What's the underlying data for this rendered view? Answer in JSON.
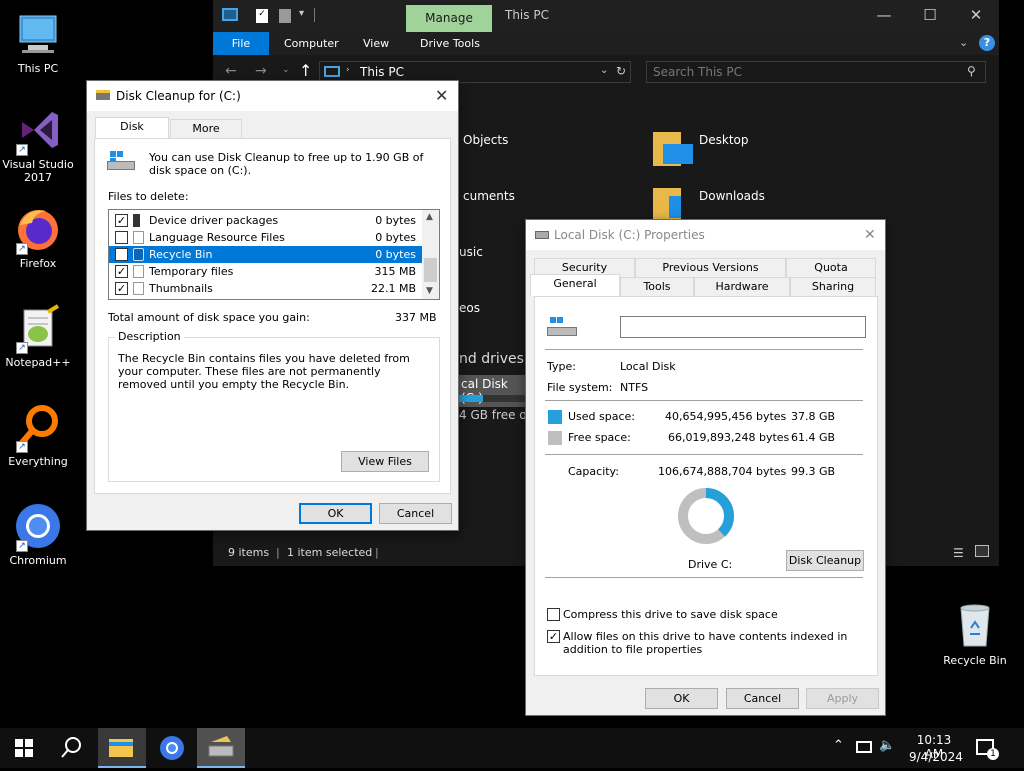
{
  "desktop": {
    "icons": [
      {
        "label": "This PC",
        "icon": "monitor-icon"
      },
      {
        "label": "Visual Studio 2017",
        "icon": "visual-studio-icon"
      },
      {
        "label": "Firefox",
        "icon": "firefox-icon"
      },
      {
        "label": "Notepad++",
        "icon": "notepadpp-icon"
      },
      {
        "label": "Everything",
        "icon": "magnifier-icon"
      },
      {
        "label": "Chromium",
        "icon": "chromium-icon"
      },
      {
        "label": "Recycle Bin",
        "icon": "recycle-bin-icon"
      }
    ]
  },
  "explorer": {
    "manage_tab": "Manage",
    "title": "This PC",
    "ribbon_tabs": [
      "File",
      "Computer",
      "View",
      "Drive Tools"
    ],
    "address": "This PC",
    "search_placeholder": "Search This PC",
    "folders": [
      "Objects",
      "Desktop",
      "cuments",
      "Downloads",
      "usic",
      "eos"
    ],
    "section_fragment": ")",
    "drives_heading": "nd drives",
    "drive_label": "cal Disk (C:)",
    "drive_free": "4 GB free of",
    "drive_used_fraction": 0.38,
    "status_items": "9 items",
    "status_selected": "1 item selected",
    "accent": "#0078d7"
  },
  "cleanup": {
    "title": "Disk Cleanup for  (C:)",
    "tabs": [
      "Disk Cleanup",
      "More Options"
    ],
    "intro": "You can use Disk Cleanup to free up to 1.90 GB of disk space on  (C:).",
    "files_label": "Files to delete:",
    "files": [
      {
        "name": "Device driver packages",
        "size": "0 bytes",
        "checked": true
      },
      {
        "name": "Language Resource Files",
        "size": "0 bytes",
        "checked": false
      },
      {
        "name": "Recycle Bin",
        "size": "0 bytes",
        "checked": true
      },
      {
        "name": "Temporary files",
        "size": "315 MB",
        "checked": true
      },
      {
        "name": "Thumbnails",
        "size": "22.1 MB",
        "checked": true
      }
    ],
    "total_label": "Total amount of disk space you gain:",
    "total_value": "337 MB",
    "description_label": "Description",
    "description": "The Recycle Bin contains files you have deleted from your computer. These files are not permanently removed until you empty the Recycle Bin.",
    "view_files": "View Files",
    "ok": "OK",
    "cancel": "Cancel"
  },
  "props": {
    "title": "Local Disk (C:) Properties",
    "tabs_top": [
      "Security",
      "Previous Versions",
      "Quota"
    ],
    "tabs_bottom": [
      "General",
      "Tools",
      "Hardware",
      "Sharing"
    ],
    "name_value": "",
    "type_label": "Type:",
    "type_value": "Local Disk",
    "fs_label": "File system:",
    "fs_value": "NTFS",
    "used_label": "Used space:",
    "used_bytes": "40,654,995,456 bytes",
    "used_gb": "37.8 GB",
    "free_label": "Free space:",
    "free_bytes": "66,019,893,248 bytes",
    "free_gb": "61.4 GB",
    "cap_label": "Capacity:",
    "cap_bytes": "106,674,888,704 bytes",
    "cap_gb": "99.3 GB",
    "used_color": "#26a0da",
    "free_color": "#bfbfbf",
    "used_fraction": 0.381,
    "drive_label": "Drive C:",
    "disk_cleanup": "Disk Cleanup",
    "compress": "Compress this drive to save disk space",
    "compress_checked": false,
    "index": "Allow files on this drive to have contents indexed in addition to file properties",
    "index_checked": true,
    "ok": "OK",
    "cancel": "Cancel",
    "apply": "Apply"
  },
  "taskbar": {
    "time": "10:13 AM",
    "date": "9/4/2024",
    "notification_count": "1"
  }
}
